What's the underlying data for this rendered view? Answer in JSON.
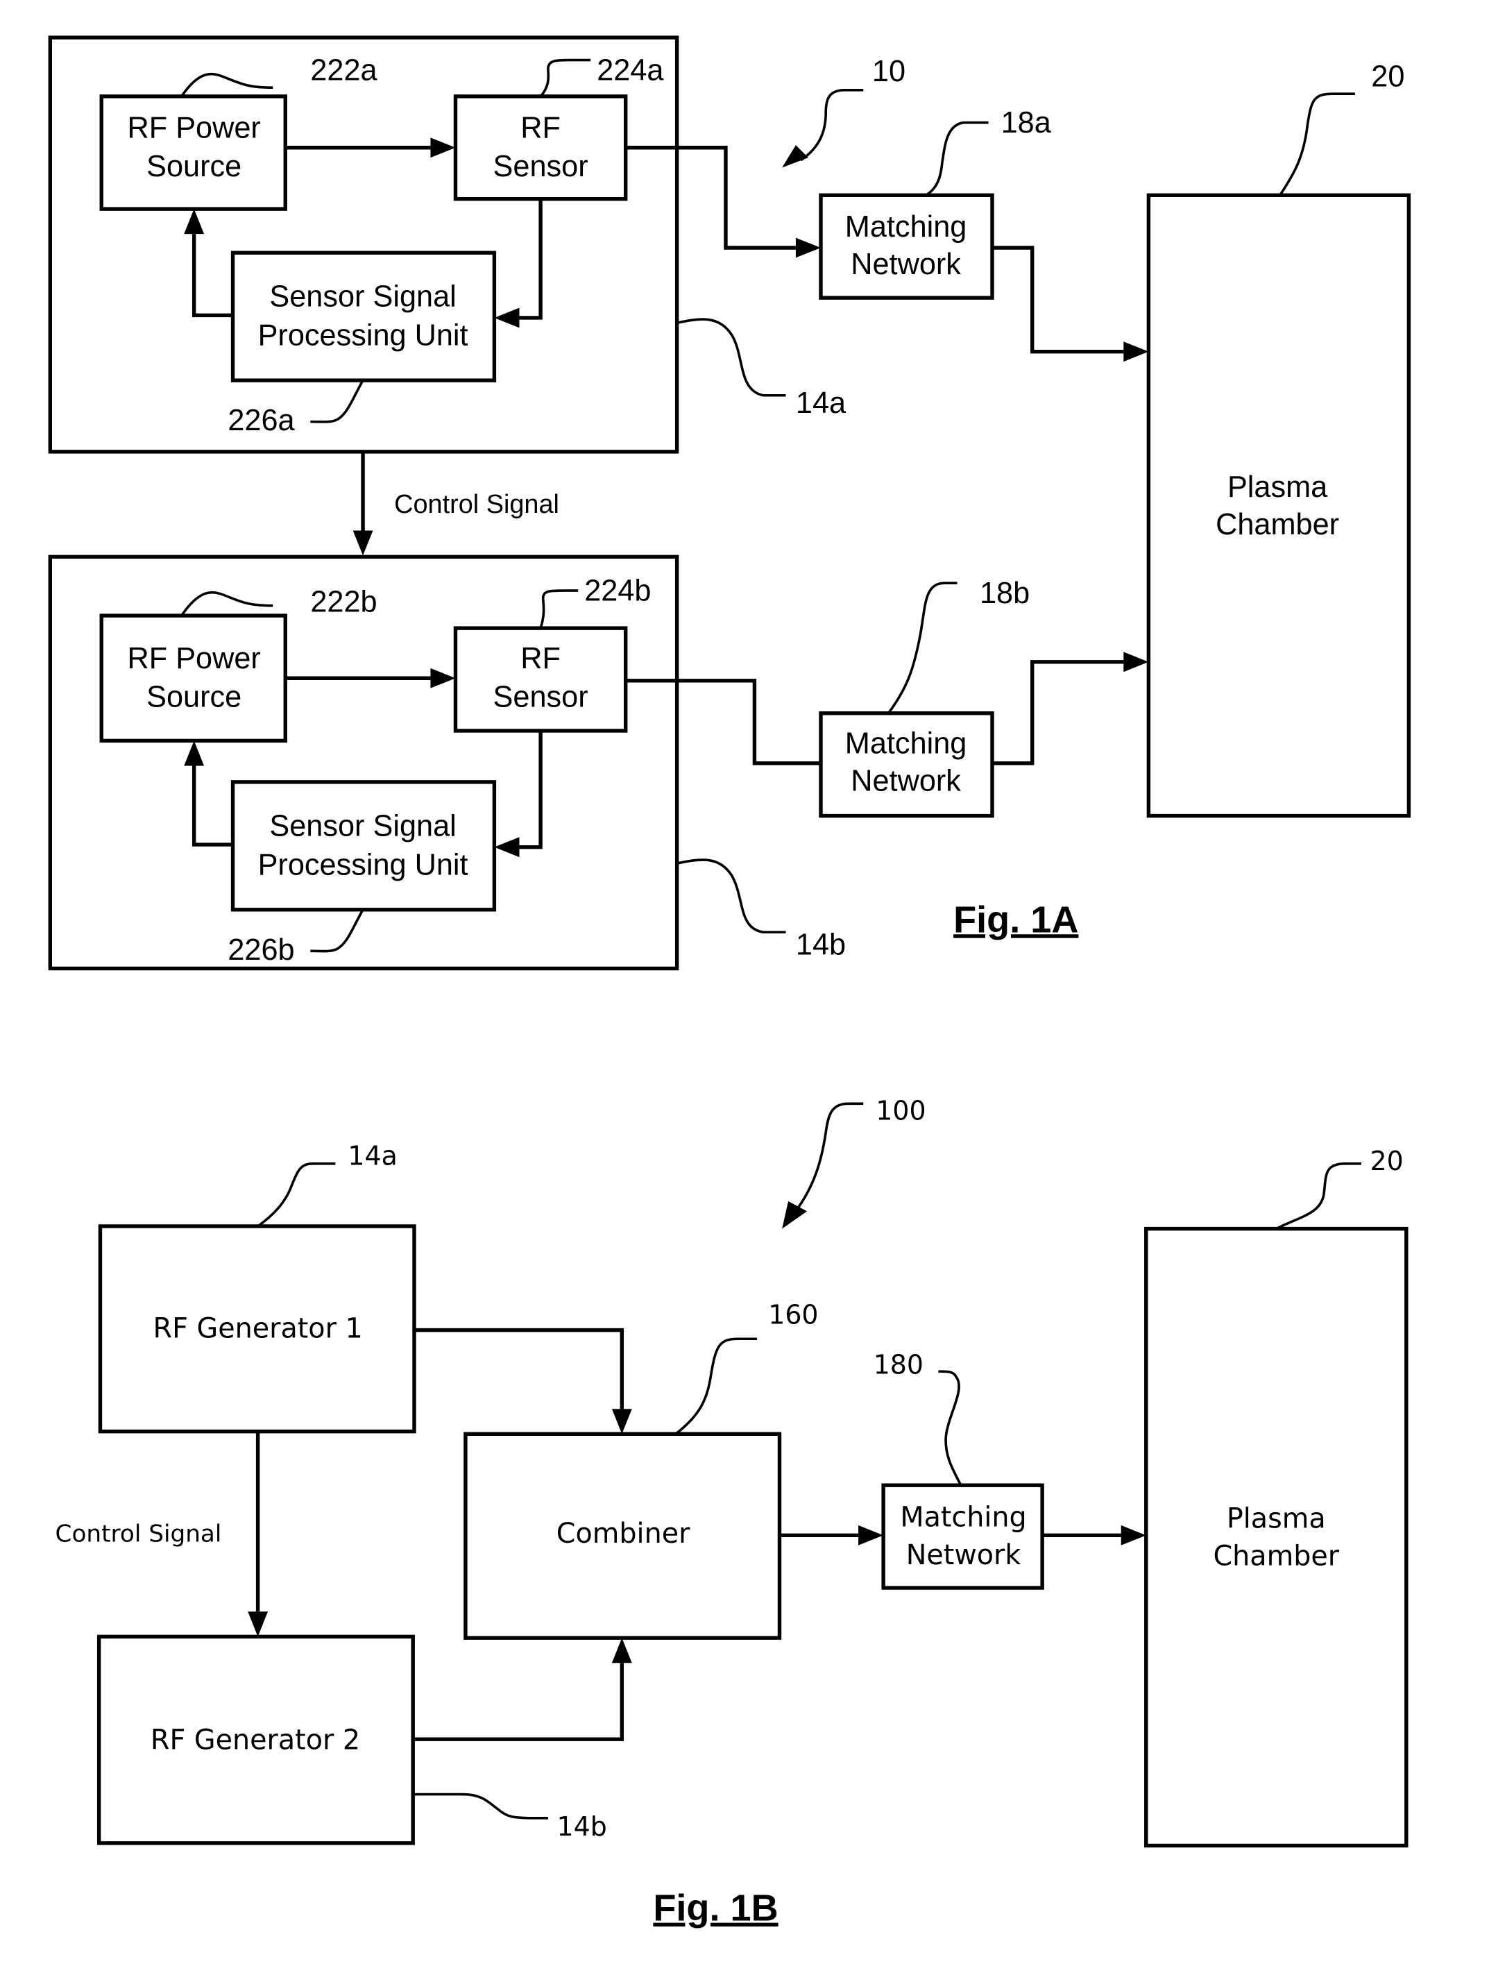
{
  "fig1a": {
    "caption": "Fig. 1A",
    "system_ref": "10",
    "generator_a": {
      "ref": "14a",
      "power_source": {
        "ref": "222a",
        "line1": "RF Power",
        "line2": "Source"
      },
      "sensor": {
        "ref": "224a",
        "line1": "RF",
        "line2": "Sensor"
      },
      "processing": {
        "ref": "226a",
        "line1": "Sensor Signal",
        "line2": "Processing Unit"
      }
    },
    "generator_b": {
      "ref": "14b",
      "power_source": {
        "ref": "222b",
        "line1": "RF Power",
        "line2": "Source"
      },
      "sensor": {
        "ref": "224b",
        "line1": "RF",
        "line2": "Sensor"
      },
      "processing": {
        "ref": "226b",
        "line1": "Sensor Signal",
        "line2": "Processing Unit"
      }
    },
    "control_signal": "Control Signal",
    "matching_a": {
      "ref": "18a",
      "line1": "Matching",
      "line2": "Network"
    },
    "matching_b": {
      "ref": "18b",
      "line1": "Matching",
      "line2": "Network"
    },
    "chamber": {
      "ref": "20",
      "line1": "Plasma",
      "line2": "Chamber"
    }
  },
  "fig1b": {
    "caption": "Fig. 1B",
    "system_ref": "100",
    "generator1": {
      "ref": "14a",
      "label": "RF Generator 1"
    },
    "generator2": {
      "ref": "14b",
      "label": "RF Generator 2"
    },
    "control_signal": "Control Signal",
    "combiner": {
      "ref": "160",
      "label": "Combiner"
    },
    "matching": {
      "ref": "180",
      "line1": "Matching",
      "line2": "Network"
    },
    "chamber": {
      "ref": "20",
      "line1": "Plasma",
      "line2": "Chamber"
    }
  }
}
